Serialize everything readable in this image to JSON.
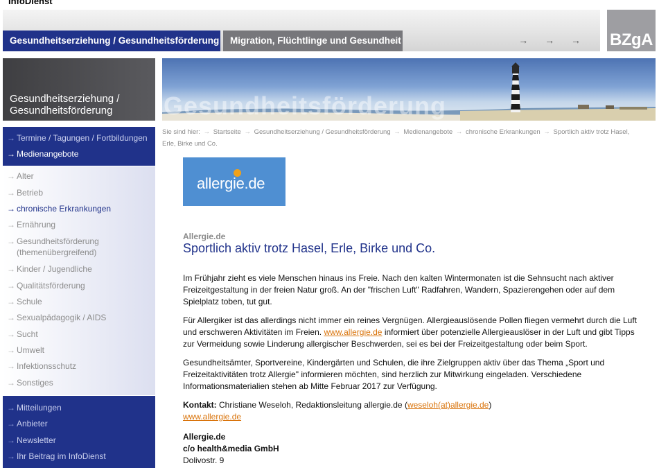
{
  "site": {
    "title": "InfoDienst"
  },
  "header": {
    "tabs": [
      {
        "label": "Gesundheitserziehung / Gesundheitsförderung",
        "active": true
      },
      {
        "label": "Migration, Flüchtlinge und Gesundheit",
        "active": false
      }
    ],
    "arrow": "→",
    "nav_arrows": "→ → →",
    "logo_text": "BZgA"
  },
  "sidebar": {
    "section_title_line1": "Gesundheitserziehung /",
    "section_title_line2": "Gesundheitsförderung",
    "chevron": "→",
    "top_items": [
      {
        "label": "Termine / Tagungen / Fortbildungen"
      },
      {
        "label": "Medienangebote",
        "current": true
      }
    ],
    "sub_items": [
      {
        "label": "Alter"
      },
      {
        "label": "Betrieb"
      },
      {
        "label": "chronische Erkrankungen",
        "current": true
      },
      {
        "label": "Ernährung"
      },
      {
        "label": "Gesundheitsförderung",
        "label2": "(themenübergreifend)"
      },
      {
        "label": "Kinder / Jugendliche"
      },
      {
        "label": "Qualitätsförderung"
      },
      {
        "label": "Schule"
      },
      {
        "label": "Sexualpädagogik / AIDS"
      },
      {
        "label": "Sucht"
      },
      {
        "label": "Umwelt"
      },
      {
        "label": "Infektionsschutz"
      },
      {
        "label": "Sonstiges"
      }
    ],
    "bottom_items": [
      {
        "label": "Mitteilungen"
      },
      {
        "label": "Anbieter"
      },
      {
        "label": "Newsletter"
      },
      {
        "label": "Ihr Beitrag im InfoDienst"
      }
    ]
  },
  "banner": {
    "word": "Gesundheitsförderung"
  },
  "breadcrumb": {
    "prefix": "Sie sind hier:",
    "sep": "→",
    "items": [
      "Startseite",
      "Gesundheitserziehung / Gesundheitsförderung",
      "Medienangebote",
      "chronische Erkrankungen",
      "Sportlich aktiv trotz Hasel, Erle, Birke und Co."
    ]
  },
  "article": {
    "logo_text": "allergie.de",
    "kicker": "Allergie.de",
    "headline": "Sportlich aktiv trotz Hasel, Erle, Birke und Co.",
    "p1": "Im Frühjahr zieht es viele Menschen hinaus ins Freie. Nach den kalten Wintermonaten ist die Sehnsucht nach aktiver Freizeitgestaltung in der freien Natur groß. An der \"frischen Luft\" Radfahren, Wandern, Spazierengehen oder auf dem Spielplatz toben, tut gut.",
    "p2_before": "Für Allergiker ist das allerdings nicht immer ein reines Vergnügen. Allergieauslösende Pollen fliegen vermehrt durch die Luft und erschweren Aktivitäten im Freien. ",
    "p2_link": "www.allergie.de",
    "p2_after": " informiert über potenzielle Allergieauslöser in der Luft und gibt Tipps zur Vermeidung sowie Linderung allergischer Beschwerden, sei es bei der Freizeitgestaltung oder beim Sport.",
    "p3": "Gesundheitsämter, Sportvereine, Kindergärten und Schulen, die ihre Zielgruppen aktiv über das Thema „Sport und Freizeitaktivitäten trotz Allergie\" informieren möchten, sind herzlich zur Mitwirkung eingeladen. Verschiedene Informationsmaterialien stehen ab Mitte Februar 2017 zur Verfügung.",
    "contact_label": "Kontakt:",
    "contact_text": " Christiane Weseloh, Redaktionsleitung allergie.de (",
    "contact_email": "weseloh(at)allergie.de",
    "contact_close": ")",
    "contact_link": "www.allergie.de",
    "address": [
      "Allergie.de",
      "c/o health&media GmbH",
      "Dolivostr. 9"
    ]
  }
}
